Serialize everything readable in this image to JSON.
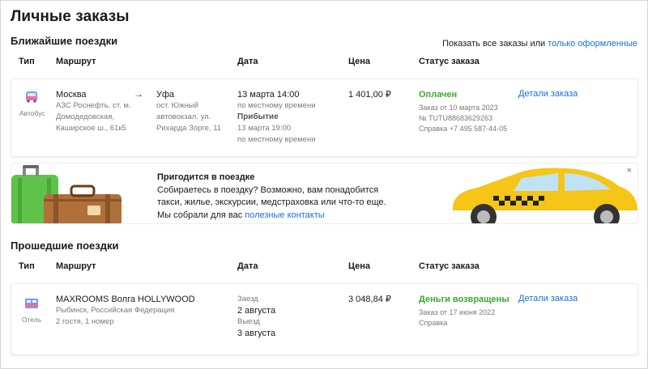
{
  "page": {
    "title": "Личные заказы"
  },
  "upcoming": {
    "heading": "Ближайшие поездки",
    "show_all_prefix": "Показать все заказы или ",
    "show_all_link": "только оформленные",
    "columns": [
      "Тип",
      "Маршрут",
      "Дата",
      "Цена",
      "Статус заказа"
    ],
    "order": {
      "type_label": "Автобус",
      "type_icon": "bus-icon",
      "from_city": "Москва",
      "from_place": [
        "АЗС Роснефть. ст. м.",
        "Домодедовская,",
        "Каширское ш., 61к5"
      ],
      "to_city": "Уфа",
      "to_place": [
        "ост. Южный",
        "автовокзал. ул.",
        "Рихарда Зорге, 11"
      ],
      "date_depart": "13 марта 14:00",
      "date_depart_note": "по местному времени",
      "arrival_label": "Прибытие",
      "date_arrive": "13 марта 19:00",
      "date_arrive_note": "по местному времени",
      "price": "1 401,00 ₽",
      "status": "Оплачен",
      "status_color": "#3aa82f",
      "order_date": "Заказ от 10 марта 2023",
      "order_number": "№ TUTU88683629263",
      "help_phone": "Справка +7 495 587-44-05",
      "details_link": "Детали заказа"
    }
  },
  "banner": {
    "title": "Пригодится в поездке",
    "line1": "Собираетесь в поездку? Возможно, вам понадобится",
    "line2": "такси, жилье, экскурсии, медстраховка или что-то еще.",
    "line3_prefix": "Мы собрали для вас ",
    "line3_link": "полезные контакты",
    "close": "×"
  },
  "past": {
    "heading": "Прошедшие поездки",
    "columns": [
      "Тип",
      "Маршрут",
      "Дата",
      "Цена",
      "Статус заказа"
    ],
    "order": {
      "type_label": "Отель",
      "type_icon": "bed-icon",
      "hotel_name": "MAXROOMS Волга HOLLYWOOD",
      "hotel_location": "Рыбинск, Российская Федерация",
      "guests": "2 гостя, 1 номер",
      "checkin_label": "Заезд",
      "checkin_date": "2 августа",
      "checkout_label": "Выезд",
      "checkout_date": "3 августа",
      "price": "3 048,84 ₽",
      "status": "Деньги возвращены",
      "status_color": "#3aa82f",
      "order_date": "Заказ от 17 июня 2022",
      "help": "Справка",
      "details_link": "Детали заказа"
    }
  }
}
